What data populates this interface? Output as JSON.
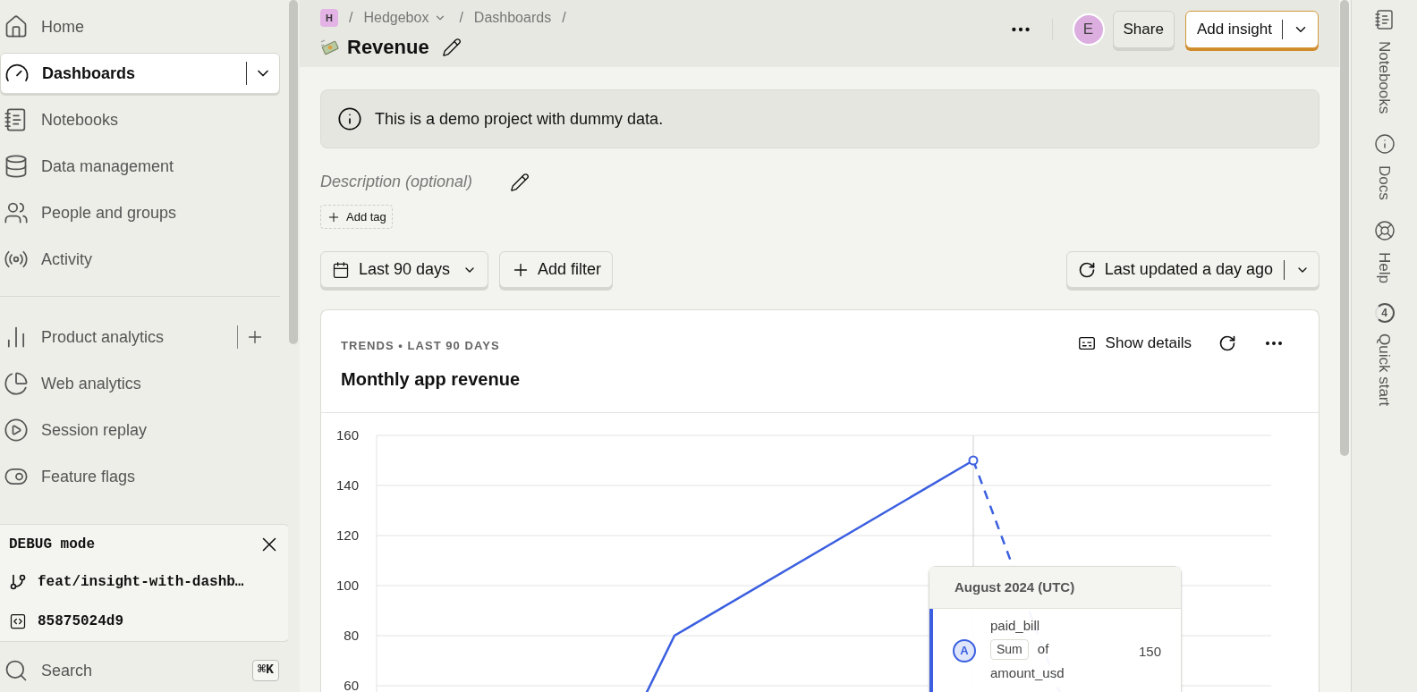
{
  "sidebar": {
    "sections": [
      [
        {
          "kind": "plain",
          "label": "Home",
          "selected": false
        },
        {
          "kind": "split",
          "label": "Dashboards",
          "selected": true
        },
        {
          "kind": "plain",
          "label": "Notebooks",
          "selected": false
        },
        {
          "kind": "plain",
          "label": "Data management",
          "selected": false
        },
        {
          "kind": "plain",
          "label": "People and groups",
          "selected": false
        },
        {
          "kind": "plain",
          "label": "Activity",
          "selected": false
        }
      ],
      [
        {
          "kind": "add",
          "label": "Product analytics",
          "selected": false
        },
        {
          "kind": "plain",
          "label": "Web analytics",
          "selected": false
        },
        {
          "kind": "plain",
          "label": "Session replay",
          "selected": false
        },
        {
          "kind": "plain",
          "label": "Feature flags",
          "selected": false
        }
      ]
    ]
  },
  "debug_panel": {
    "title": "DEBUG mode",
    "branch": "feat/insight-with-dashb…",
    "commit": "85875024d9"
  },
  "search": {
    "label": "Search",
    "shortcut": "⌘K"
  },
  "header": {
    "breadcrumbs": [
      {
        "kind": "badge",
        "label": "H"
      },
      {
        "kind": "separator",
        "label": "/"
      },
      {
        "kind": "link",
        "label": "Hedgebox",
        "dropdown": true
      },
      {
        "kind": "separator",
        "label": "/"
      },
      {
        "kind": "link",
        "label": "Dashboards",
        "dropdown": false
      },
      {
        "kind": "separator",
        "label": "/"
      }
    ],
    "title": "Revenue",
    "avatar": "E",
    "share": "Share",
    "add_insight": "Add insight"
  },
  "banner": "This is a demo project with dummy data.",
  "description": {
    "placeholder": "Description (optional)"
  },
  "add_tag": "Add tag",
  "filters": {
    "date_range": "Last 90 days",
    "add_filter": "Add filter",
    "refresh": "Last updated a day ago"
  },
  "insight": {
    "subtitle": "TRENDS • LAST 90 DAYS",
    "title": "Monthly app revenue",
    "show_details": "Show details",
    "y_axis_labels": [
      "160",
      "140",
      "120",
      "100",
      "80",
      "60"
    ],
    "tooltip": {
      "title": "August 2024 (UTC)",
      "letter": "A",
      "event": "paid_bill",
      "math": "Sum",
      "of": "of",
      "property": "amount_usd",
      "value": "150"
    }
  },
  "right_rail": [
    {
      "label": "Notebooks"
    },
    {
      "label": "Docs"
    },
    {
      "label": "Help"
    },
    {
      "label": "Quick start",
      "badge": "4"
    }
  ]
}
